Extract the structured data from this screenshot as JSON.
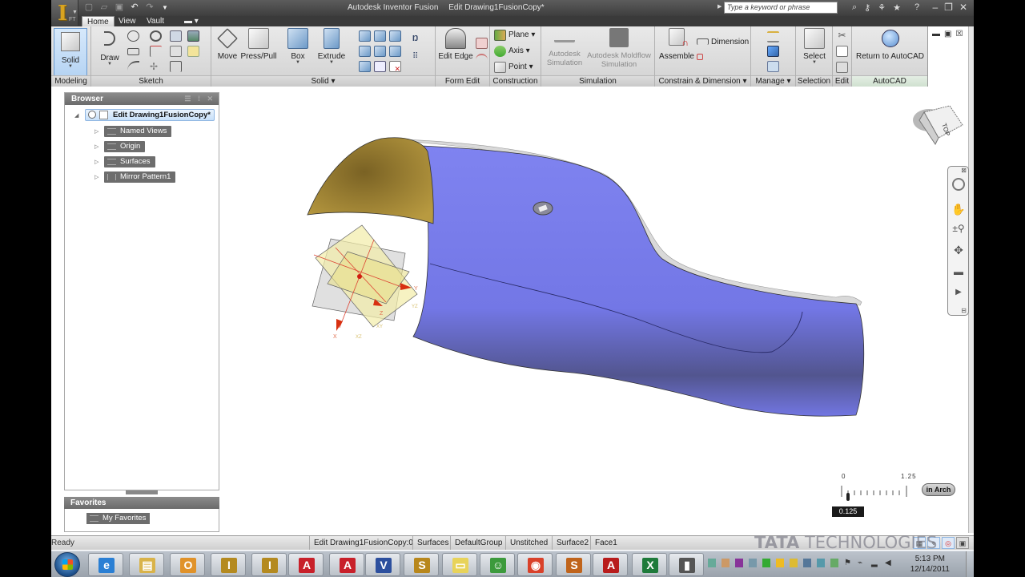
{
  "window": {
    "app_name": "Autodesk Inventor Fusion",
    "document_title": "Edit Drawing1FusionCopy*",
    "app_logo_text": "I",
    "app_logo_sub": "FT",
    "search_placeholder": "Type a keyword or phrase",
    "title_icons": [
      "binoculars-icon",
      "key-icon",
      "satellite-icon",
      "star-icon",
      "help-icon"
    ],
    "window_controls": {
      "minimize": "–",
      "restore": "❐",
      "close": "✕"
    }
  },
  "quick_access": [
    "new-icon",
    "open-icon",
    "save-icon",
    "undo-icon",
    "redo-icon",
    "customize-dropdown-icon"
  ],
  "tabs": [
    {
      "label": "Home",
      "active": true
    },
    {
      "label": "View",
      "active": false
    },
    {
      "label": "Vault",
      "active": false
    },
    {
      "label": "▬ ▾",
      "active": false
    }
  ],
  "ribbon": {
    "panels": {
      "modeling": {
        "label": "Modeling",
        "solid_button": "Solid"
      },
      "sketch": {
        "label": "Sketch",
        "draw_button": "Draw"
      },
      "solid": {
        "label": "Solid ▾",
        "move": "Move",
        "press_pull": "Press/Pull",
        "box": "Box",
        "extrude": "Extrude"
      },
      "form_edit": {
        "label": "Form Edit",
        "edit_edge": "Edit Edge"
      },
      "construction": {
        "label": "Construction",
        "plane": "Plane ▾",
        "axis": "Axis ▾",
        "point": "Point ▾"
      },
      "simulation": {
        "label": "Simulation",
        "autodesk_sim_1": "Autodesk",
        "autodesk_sim_2": "Simulation",
        "moldflow_1": "Autodesk Moldflow",
        "moldflow_2": "Simulation"
      },
      "constrain": {
        "label": "Constrain & Dimension ▾",
        "assemble": "Assemble",
        "dimension": "Dimension"
      },
      "manage": {
        "label": "Manage ▾"
      },
      "selection": {
        "label": "Selection",
        "select": "Select"
      },
      "edit": {
        "label": "Edit"
      },
      "autocad": {
        "label": "AutoCAD",
        "return": "Return to AutoCAD"
      }
    }
  },
  "browser": {
    "title": "Browser",
    "root": "Edit Drawing1FusionCopy*",
    "nodes": [
      "Named Views",
      "Origin",
      "Surfaces",
      "Mirror Pattern1"
    ]
  },
  "favorites": {
    "title": "Favorites",
    "nodes": [
      "My Favorites"
    ]
  },
  "viewcube": {
    "face_label": "TOP"
  },
  "origin_triad": {
    "labels": [
      "X",
      "Y",
      "Z",
      "XY",
      "YZ",
      "XZ"
    ]
  },
  "scale_bar": {
    "min_label": "0",
    "max_label": "1.25",
    "unit_label": "in Arch",
    "current_value": "0.125"
  },
  "statusbar": {
    "status": "Ready",
    "cells": [
      "Edit Drawing1FusionCopy:0",
      "Surfaces",
      "DefaultGroup",
      "Unstitched",
      "Surface2",
      "Face1"
    ]
  },
  "watermark": {
    "bold": "TATA",
    "light": " TECHNOLOGIES"
  },
  "taskbar": {
    "apps": [
      {
        "name": "internet-explorer",
        "glyph": "e",
        "color": "#2a7fd4"
      },
      {
        "name": "windows-explorer",
        "glyph": "▤",
        "color": "#d9b34a"
      },
      {
        "name": "outlook",
        "glyph": "O",
        "color": "#e0922a"
      },
      {
        "name": "inventor-pro-1",
        "glyph": "I",
        "color": "#b48a20"
      },
      {
        "name": "inventor-pro-2",
        "glyph": "I",
        "color": "#b48a20"
      },
      {
        "name": "autocad-1",
        "glyph": "A",
        "color": "#c8202a"
      },
      {
        "name": "autocad-2",
        "glyph": "A",
        "color": "#c8202a"
      },
      {
        "name": "vault",
        "glyph": "V",
        "color": "#2c4f9e"
      },
      {
        "name": "showcase",
        "glyph": "S",
        "color": "#b8871c"
      },
      {
        "name": "sticky-notes",
        "glyph": "▭",
        "color": "#e8d35a"
      },
      {
        "name": "messenger",
        "glyph": "☺",
        "color": "#3c9a3c"
      },
      {
        "name": "chrome",
        "glyph": "◉",
        "color": "#d9412a"
      },
      {
        "name": "sketchbook",
        "glyph": "S",
        "color": "#c0641c"
      },
      {
        "name": "adobe-reader",
        "glyph": "A",
        "color": "#b81c1c"
      },
      {
        "name": "excel",
        "glyph": "X",
        "color": "#1e7a3a"
      },
      {
        "name": "camtasia",
        "glyph": "▮",
        "color": "#555"
      }
    ],
    "clock_time": "5:13 PM",
    "clock_date": "12/14/2011"
  },
  "colors": {
    "surface_blue": "#7b7fee",
    "surface_gold": "#a88a32",
    "ribbon_highlight": "#b6d4f3"
  }
}
